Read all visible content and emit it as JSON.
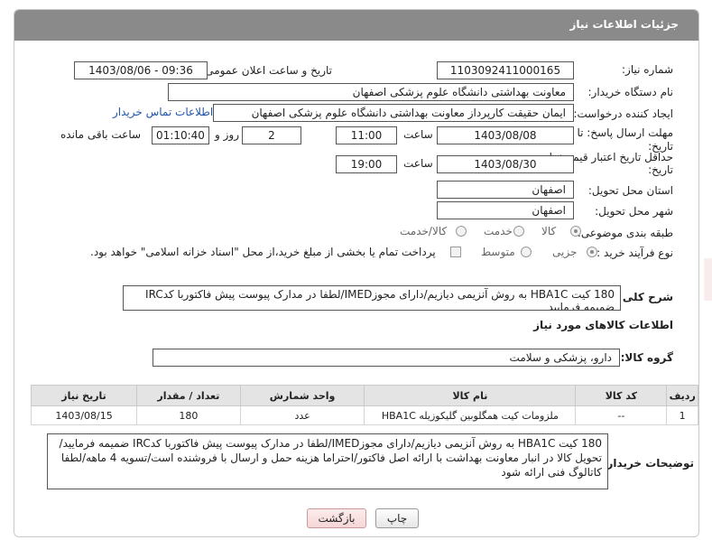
{
  "header": {
    "title": "جزئیات اطلاعات نیاز"
  },
  "fields": {
    "need_number_label": "شماره نیاز:",
    "need_number": "1103092411000165",
    "announce_label": "تاریخ و ساعت اعلان عمومی:",
    "announce_value": "1403/08/06 - 09:36",
    "buyer_org_label": "نام دستگاه خریدار:",
    "buyer_org": "معاونت بهداشتی دانشگاه علوم پزشکی اصفهان",
    "creator_label": "ایجاد کننده درخواست:",
    "creator": "ایمان حقیقت کارپرداز معاونت بهداشتی دانشگاه علوم پزشکی اصفهان",
    "contact_link": "اطلاعات تماس خریدار",
    "deadline_label_1": "مهلت ارسال پاسخ: تا",
    "deadline_label_2": "تاریخ:",
    "deadline_date": "1403/08/08",
    "time_label": "ساعت",
    "deadline_time": "11:00",
    "days_value": "2",
    "days_label": "روز و",
    "remaining_time": "01:10:40",
    "remaining_label": "ساعت باقی مانده",
    "validity_label_1": "حداقل تاریخ اعتبار قیمت: تا",
    "validity_label_2": "تاریخ:",
    "validity_date": "1403/08/30",
    "validity_time_label": "ساعت",
    "validity_time": "19:00",
    "province_label": "استان محل تحویل:",
    "province": "اصفهان",
    "city_label": "شهر محل تحویل:",
    "city": "اصفهان",
    "category_label": "طبقه بندی موضوعی:",
    "category_options": [
      "کالا",
      "خدمت",
      "کالا/خدمت"
    ],
    "process_label": "نوع فرآیند خرید :",
    "process_options": [
      "جزیی",
      "متوسط"
    ],
    "payment_note": "پرداخت تمام یا بخشی از مبلغ خرید،از محل \"اسناد خزانه اسلامی\" خواهد بود."
  },
  "summary": {
    "label": "شرح کلی نیاز:",
    "text": "180 کیت HBA1C به روش آنزیمی دیازیم/دارای مجوزIMED/لطفا در مدارک پیوست پیش فاکتوربا کدIRC ضمیمه فرمایید"
  },
  "goods": {
    "section_title": "اطلاعات کالاهای مورد نیاز",
    "group_label": "گروه کالا:",
    "group_value": "دارو، پزشکی و سلامت",
    "columns": [
      "ردیف",
      "کد کالا",
      "نام کالا",
      "واحد شمارش",
      "تعداد / مقدار",
      "تاریخ نیاز"
    ],
    "rows": [
      [
        "1",
        "--",
        "ملزومات کیت همگلوبین گلیکوزیله HBA1C",
        "عدد",
        "180",
        "1403/08/15"
      ]
    ]
  },
  "buyer_notes": {
    "label": "توضیحات خریدار:",
    "text": "180 کیت HBA1C به روش آنزیمی دیازیم/دارای مجوزIMED/لطفا در مدارک پیوست پیش فاکتوربا کدIRC ضمیمه فرمایید/تحویل کالا در انبار معاونت بهداشت با ارائه اصل فاکتور/احتراما هزینه حمل و ارسال با فروشنده است/تسویه 4 ماهه/لطفا کاتالوگ فنی ارائه شود"
  },
  "buttons": {
    "print": "چاپ",
    "back": "بازگشت"
  },
  "watermark": {
    "text": "AriaTender.neT"
  }
}
